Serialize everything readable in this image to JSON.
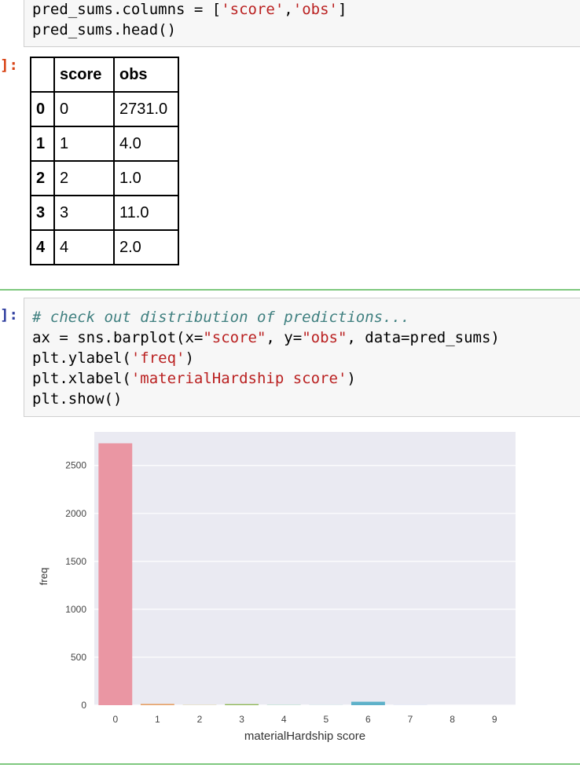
{
  "cell1": {
    "prompt": "]:",
    "code": {
      "line1": {
        "a": "pred_sums.columns = [",
        "s1": "'score'",
        "b": ",",
        "s2": "'obs'",
        "c": "]"
      },
      "line2": "pred_sums.head()"
    },
    "table": {
      "headers": [
        "",
        "score",
        "obs"
      ],
      "rows": [
        {
          "index": "0",
          "score": "0",
          "obs": "2731.0"
        },
        {
          "index": "1",
          "score": "1",
          "obs": "4.0"
        },
        {
          "index": "2",
          "score": "2",
          "obs": "1.0"
        },
        {
          "index": "3",
          "score": "3",
          "obs": "11.0"
        },
        {
          "index": "4",
          "score": "4",
          "obs": "2.0"
        }
      ]
    }
  },
  "cell2": {
    "prompt": "]:",
    "code": {
      "comment": "# check out distribution of predictions...",
      "line2": {
        "a": "ax = sns.barplot(x=",
        "s1": "\"score\"",
        "b": ", y=",
        "s2": "\"obs\"",
        "c": ", data=pred_sums)"
      },
      "line3": {
        "a": "plt.ylabel(",
        "s1": "'freq'",
        "c": ")"
      },
      "line4": {
        "a": "plt.xlabel(",
        "s1": "'materialHardship score'",
        "c": ")"
      },
      "line5": "plt.show()"
    }
  },
  "colors": {
    "code_bg": "#f7f7f7",
    "prompt_out": "#d84315",
    "prompt_in": "#303f9f",
    "string": "#ba2121",
    "comment": "#408080",
    "divider": "#7ec87e",
    "plot_bg": "#eaeaf2"
  },
  "chart_data": {
    "type": "bar",
    "categories": [
      "0",
      "1",
      "2",
      "3",
      "4",
      "5",
      "6",
      "7",
      "8",
      "9"
    ],
    "values": [
      2731,
      13,
      2,
      11,
      2,
      1,
      36,
      1,
      0,
      0
    ],
    "colors": [
      "#ea96a3",
      "#e6a064",
      "#c4b156",
      "#8fb755",
      "#57b78d",
      "#5bb4ac",
      "#5eb1c9",
      "#8ba7e6",
      "#c79be8",
      "#e790d8"
    ],
    "xlabel": "materialHardship score",
    "ylabel": "freq",
    "yticks": [
      0,
      500,
      1000,
      1500,
      2000,
      2500
    ],
    "ylim": [
      0,
      2850
    ],
    "grid": true
  }
}
